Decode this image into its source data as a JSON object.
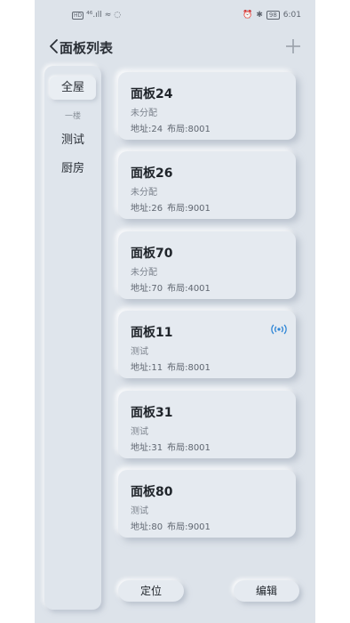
{
  "status_bar": {
    "left": [
      "HD",
      "⁴⁶.ıll",
      "≈",
      "◌"
    ],
    "battery": "98",
    "time": "6:01"
  },
  "header": {
    "title": "面板列表",
    "back_icon": "chevron-left-icon",
    "add_icon": "plus-icon"
  },
  "sidebar": {
    "items": [
      {
        "label": "全屋",
        "active": true
      },
      {
        "label": "一楼",
        "sub": true
      },
      {
        "label": "测试"
      },
      {
        "label": "厨房"
      }
    ]
  },
  "panels": [
    {
      "name": "面板24",
      "room": "未分配",
      "address": "地址:24",
      "layout": "布局:8001",
      "signal": false
    },
    {
      "name": "面板26",
      "room": "未分配",
      "address": "地址:26",
      "layout": "布局:9001",
      "signal": false
    },
    {
      "name": "面板70",
      "room": "未分配",
      "address": "地址:70",
      "layout": "布局:4001",
      "signal": false
    },
    {
      "name": "面板11",
      "room": "测试",
      "address": "地址:11",
      "layout": "布局:8001",
      "signal": true
    },
    {
      "name": "面板31",
      "room": "测试",
      "address": "地址:31",
      "layout": "布局:8001",
      "signal": false
    },
    {
      "name": "面板80",
      "room": "测试",
      "address": "地址:80",
      "layout": "布局:9001",
      "signal": false
    }
  ],
  "footer": {
    "locate_label": "定位",
    "edit_label": "编辑"
  },
  "colors": {
    "background": "#dde3ea",
    "signal": "#2f86d6"
  }
}
